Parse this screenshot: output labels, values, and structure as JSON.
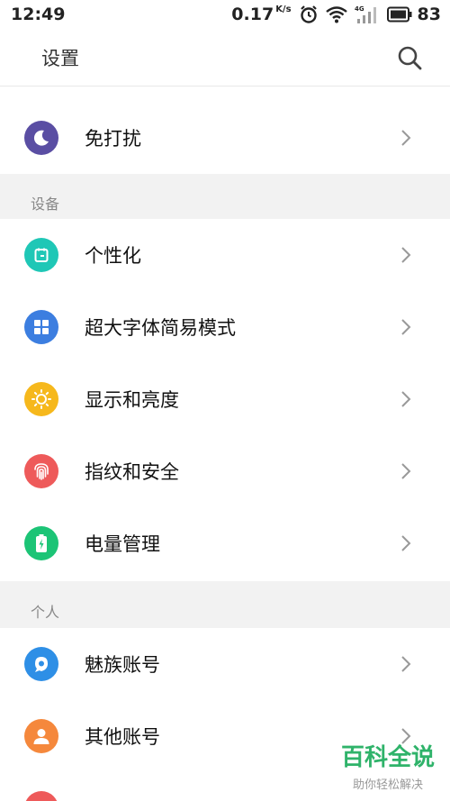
{
  "status": {
    "time": "12:49",
    "speed": "0.17",
    "speed_unit": "K/s",
    "network": "4G",
    "battery": "83"
  },
  "header": {
    "title": "设置",
    "search_icon": "search-icon"
  },
  "sections": {
    "device": "设备",
    "personal": "个人"
  },
  "items": [
    {
      "label": "免打扰",
      "icon": "moon-icon",
      "color": "#5a4ea3"
    },
    {
      "label": "个性化",
      "icon": "personalize-icon",
      "color": "#1fc7b6"
    },
    {
      "label": "超大字体简易模式",
      "icon": "grid-icon",
      "color": "#3c7ee0"
    },
    {
      "label": "显示和亮度",
      "icon": "sun-icon",
      "color": "#f6b81c"
    },
    {
      "label": "指纹和安全",
      "icon": "fingerprint-icon",
      "color": "#ee5a5a"
    },
    {
      "label": "电量管理",
      "icon": "battery-icon",
      "color": "#1cc476"
    },
    {
      "label": "魅族账号",
      "icon": "flyme-account-icon",
      "color": "#2e8fe6"
    },
    {
      "label": "其他账号",
      "icon": "person-icon",
      "color": "#f5883c"
    }
  ],
  "watermark": {
    "main": "百科全说",
    "sub": "助你轻松解决"
  }
}
